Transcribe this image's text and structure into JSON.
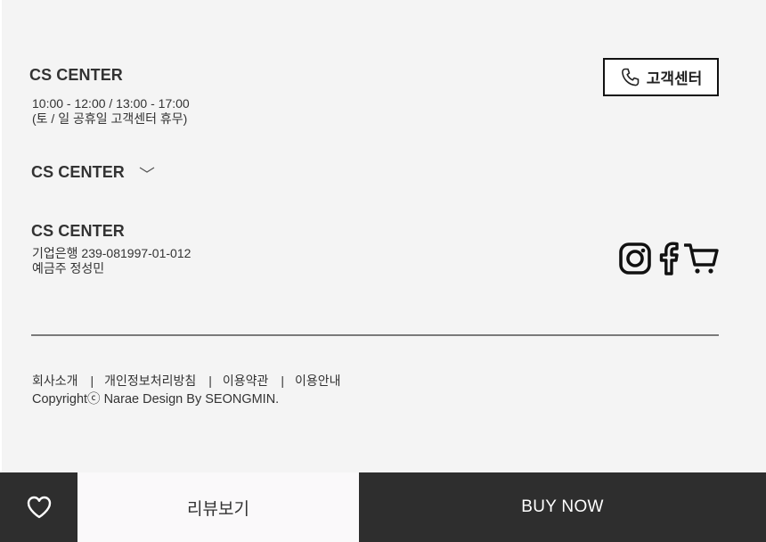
{
  "cs_info": {
    "title": "CS CENTER",
    "hours": "10:00 - 12:00 / 13:00 - 17:00",
    "holiday": "(토 / 일 공휴일 고객센터 휴무)"
  },
  "cs_toggle": {
    "title": "CS CENTER"
  },
  "bank_info": {
    "title": "CS CENTER",
    "account": "기업은행 239-081997-01-012",
    "holder": "예금주 정성민"
  },
  "cs_button": {
    "label": "고객센터",
    "icon": "phone-icon"
  },
  "social": {
    "icons": [
      "instagram-icon",
      "facebook-icon",
      "cart-icon"
    ]
  },
  "footer_links": {
    "separator": "|",
    "items": [
      "회사소개",
      "개인정보처리방침",
      "이용약관",
      "이용안내"
    ]
  },
  "copyright": "Copyrightⓒ Narae Design By SEONGMIN.",
  "bottom_bar": {
    "wish_icon": "heart-icon",
    "review_label": "리뷰보기",
    "buy_label": "BUY NOW"
  },
  "colors": {
    "panel_bg": "#f4f4f4",
    "dark_bar": "#2e2e2e",
    "text": "#333333"
  }
}
